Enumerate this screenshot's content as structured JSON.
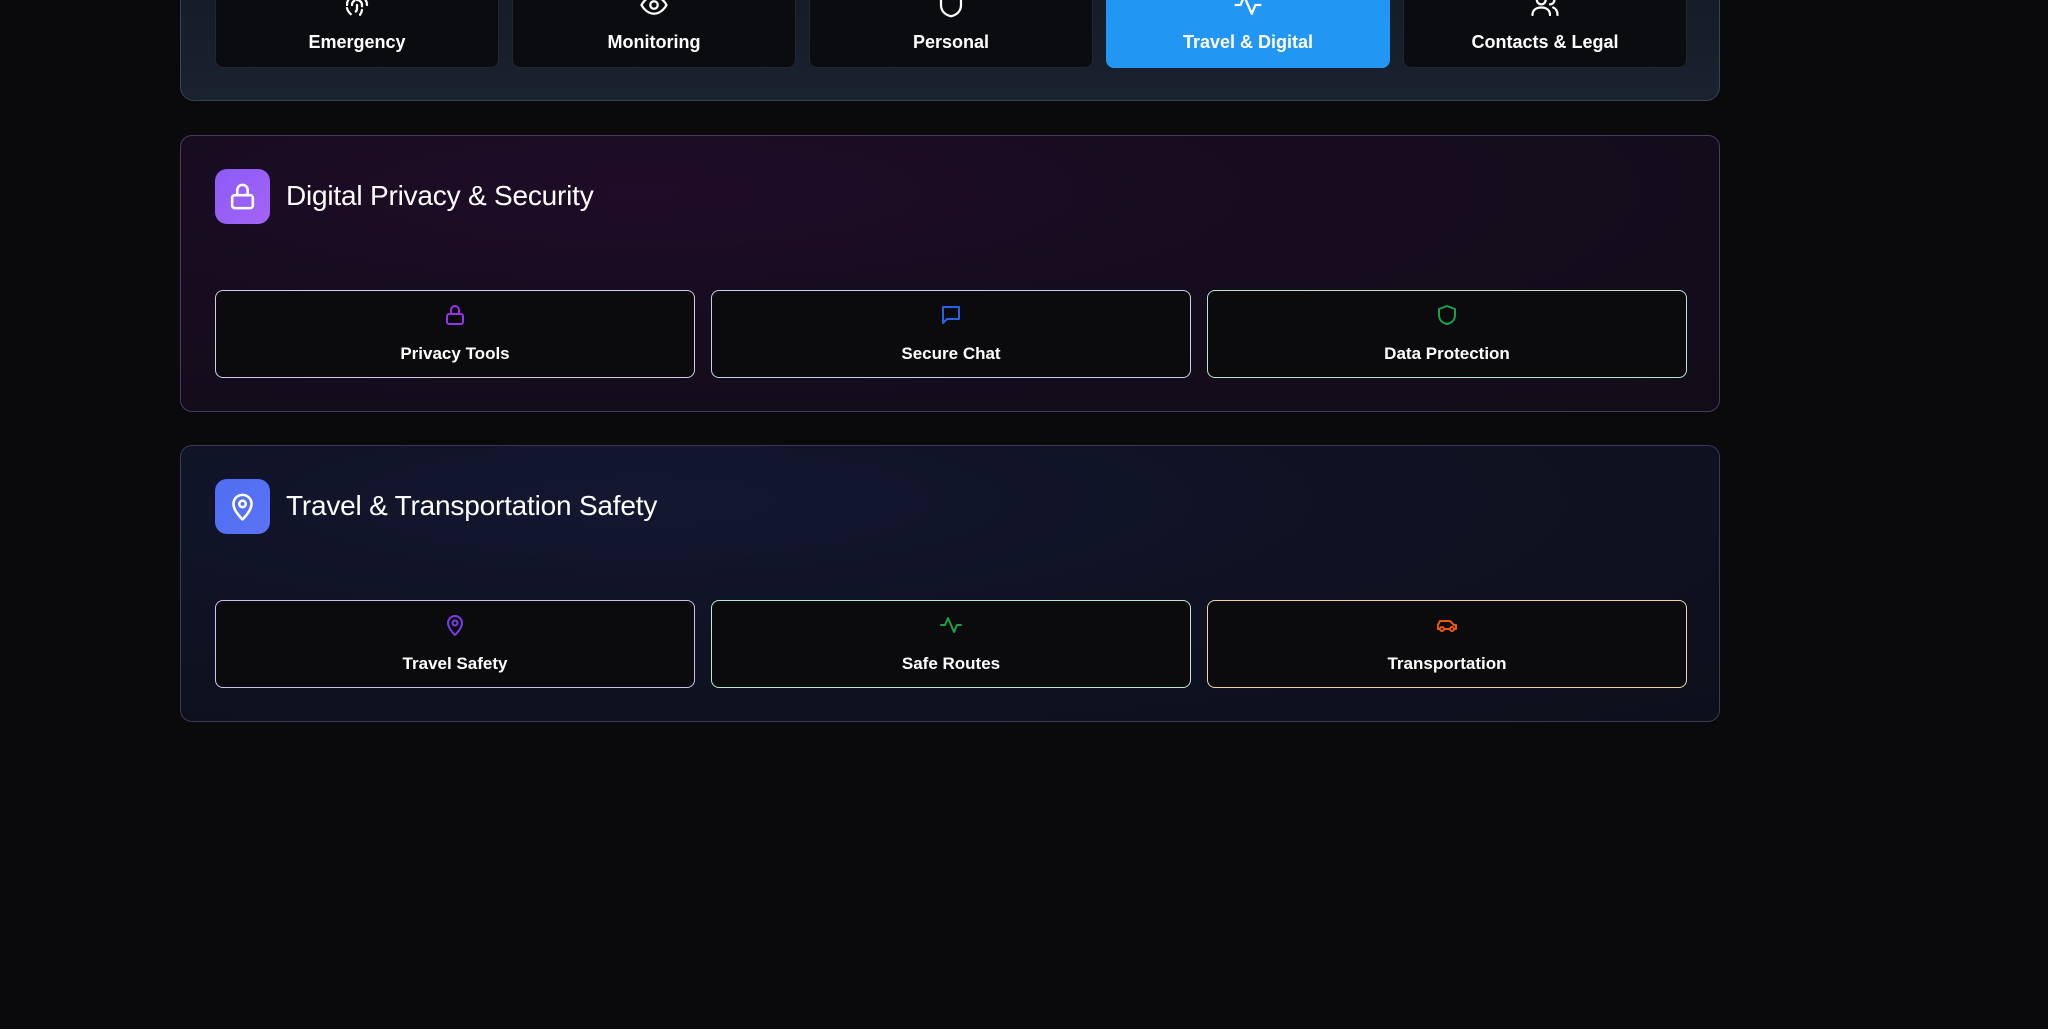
{
  "categories": [
    {
      "label": "Emergency",
      "icon": "fingerprint-icon",
      "active": false
    },
    {
      "label": "Monitoring",
      "icon": "eye-icon",
      "active": false
    },
    {
      "label": "Personal",
      "icon": "shield-icon",
      "active": false
    },
    {
      "label": "Travel & Digital",
      "icon": "activity-icon",
      "active": true
    },
    {
      "label": "Contacts & Legal",
      "icon": "users-icon",
      "active": false
    }
  ],
  "colors": {
    "active_tab": "#2196f3",
    "privacy_accent": "#8b5cf6",
    "travel_accent": "#4f6ef2",
    "purple": "#9333ea",
    "blue": "#2563eb",
    "green": "#16a34a",
    "violet": "#7c3aed",
    "orange": "#ea580c"
  },
  "sections": {
    "privacy": {
      "title": "Digital Privacy & Security",
      "icon": "lock-icon",
      "tools": [
        {
          "label": "Privacy Tools",
          "icon": "lock-icon"
        },
        {
          "label": "Secure Chat",
          "icon": "message-square-icon"
        },
        {
          "label": "Data Protection",
          "icon": "shield-icon"
        }
      ]
    },
    "travel": {
      "title": "Travel & Transportation Safety",
      "icon": "map-pin-icon",
      "tools": [
        {
          "label": "Travel Safety",
          "icon": "map-pin-icon"
        },
        {
          "label": "Safe Routes",
          "icon": "activity-icon"
        },
        {
          "label": "Transportation",
          "icon": "car-icon"
        }
      ]
    }
  }
}
